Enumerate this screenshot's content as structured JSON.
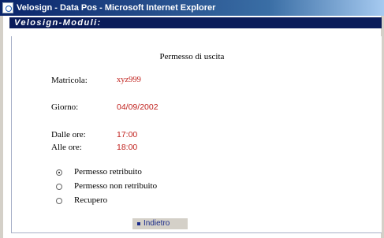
{
  "window": {
    "title": "Velosign - Data Pos - Microsoft Internet Explorer"
  },
  "header": {
    "title": "Velosign-Moduli:"
  },
  "form": {
    "title": "Permesso di uscita",
    "matricola": {
      "label": "Matricola:",
      "value": "xyz999"
    },
    "giorno": {
      "label": "Giorno:",
      "value": "04/09/2002"
    },
    "dalle": {
      "label": "Dalle ore:",
      "value": "17:00"
    },
    "alle": {
      "label": "Alle ore:",
      "value": "18:00"
    },
    "options": [
      {
        "label": "Permesso retribuito",
        "checked": true
      },
      {
        "label": "Permesso non retribuito",
        "checked": false
      },
      {
        "label": "Recupero",
        "checked": false
      }
    ]
  },
  "actions": {
    "back_label": "Indietro"
  },
  "colors": {
    "title_bar": "#0a246a",
    "header_bar": "#0a1c5a",
    "value_text": "#c0201c",
    "link": "#1a2b8a"
  }
}
